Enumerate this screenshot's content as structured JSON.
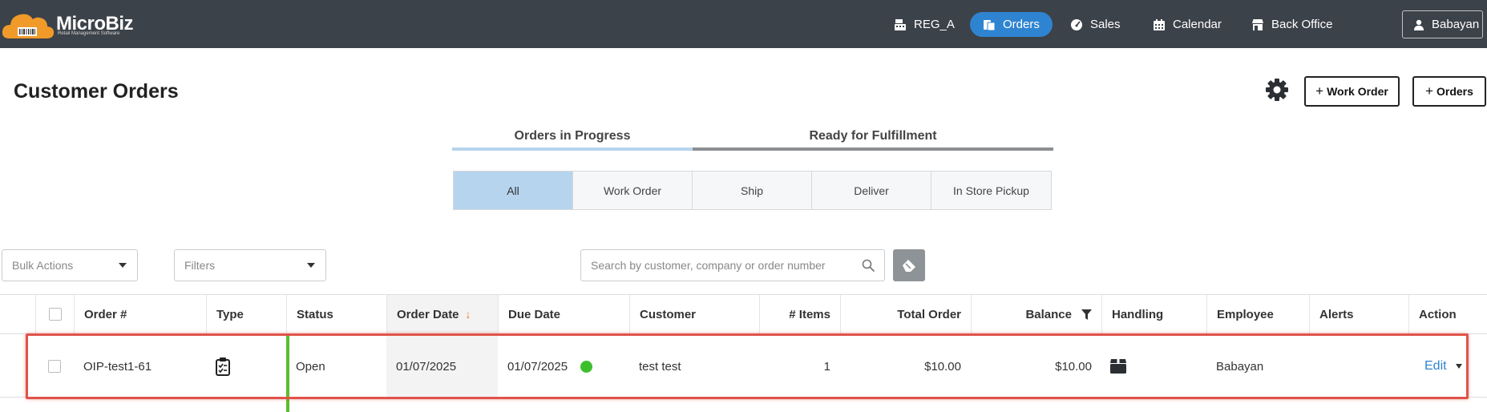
{
  "app": {
    "brand": "MicroBiz",
    "tagline": "Retail Management Software",
    "colors": {
      "topbar": "#3c4249",
      "accent": "#2f84d1",
      "status_open": "#5bbd2e",
      "highlight": "#e0534a"
    }
  },
  "nav": {
    "items": [
      {
        "label": "REG_A",
        "icon": "register-icon"
      },
      {
        "label": "Orders",
        "icon": "orders-icon",
        "active": true
      },
      {
        "label": "Sales",
        "icon": "dashboard-gauge-icon"
      },
      {
        "label": "Calendar",
        "icon": "calendar-icon"
      },
      {
        "label": "Back Office",
        "icon": "store-icon"
      }
    ],
    "user": "Babayan"
  },
  "header": {
    "title": "Customer Orders",
    "work_order_button": "Work Order",
    "orders_button": "Orders",
    "plus": "+"
  },
  "progress_tabs": [
    {
      "label": "Orders in Progress",
      "active": true
    },
    {
      "label": "Ready for Fulfillment",
      "active": false
    }
  ],
  "segments": [
    "All",
    "Work Order",
    "Ship",
    "Deliver",
    "In Store Pickup"
  ],
  "toolbar": {
    "bulk_actions": "Bulk Actions",
    "filters": "Filters",
    "search_placeholder": "Search by customer, company or order number"
  },
  "table": {
    "columns": [
      "Order #",
      "Type",
      "Status",
      "Order Date",
      "Due Date",
      "Customer",
      "# Items",
      "Total Order",
      "Balance",
      "Handling",
      "Employee",
      "Alerts",
      "Action"
    ],
    "sort_indicator": "↓",
    "rows": [
      {
        "order_number": "OIP-test1-61",
        "type_icon": "clipboard-icon",
        "status": "Open",
        "order_date": "01/07/2025",
        "due_date": "01/07/2025",
        "customer": "test test",
        "items": "1",
        "total_order": "$10.00",
        "balance": "$10.00",
        "handling_icon": "box-icon",
        "employee": "Babayan",
        "alerts": "",
        "action": "Edit"
      }
    ]
  }
}
